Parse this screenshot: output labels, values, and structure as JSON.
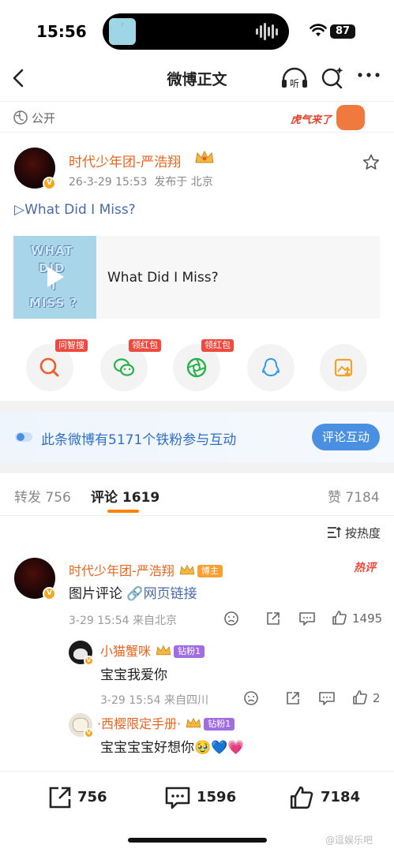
{
  "status_bar": {
    "time": "15:56",
    "battery": "87"
  },
  "navbar": {
    "title": "微博正文",
    "listen_label": "听"
  },
  "privacy": {
    "label": "公开",
    "badge_text": "虎气来了"
  },
  "post": {
    "author": "时代少年团-严浩翔",
    "time": "26-3-29 15:53",
    "location": "发布于 北京",
    "text": "▷What Did I Miss?",
    "media_title": "What Did I Miss?",
    "thumb_words": [
      "WHAT",
      "DID",
      "I",
      "MISS ?"
    ]
  },
  "share": {
    "tags": [
      "问智搜",
      "领红包",
      "领红包"
    ]
  },
  "banner": {
    "text": "此条微博有5171个铁粉参与互动",
    "button": "评论互动"
  },
  "tabs": {
    "repost": "转发 756",
    "comments": "评论 1619",
    "likes": "赞 7184"
  },
  "sort": {
    "label": "按热度"
  },
  "comments": [
    {
      "name": "时代少年团-严浩翔",
      "tag": "博主",
      "hot": "热评",
      "text_prefix": "图片评论",
      "link": "网页链接",
      "meta": "3-29 15:54  来自北京",
      "likes": "1495"
    },
    {
      "name": "小猫蟹咪",
      "tag": "钻粉1",
      "text": "宝宝我爱你",
      "meta": "3-29 15:54  来自四川",
      "likes": "2"
    },
    {
      "name": "·西樱限定手册·",
      "tag": "钻粉1",
      "text": "宝宝宝宝好想你🥹💙💗"
    }
  ],
  "bottom_bar": {
    "reposts": "756",
    "comments": "1596",
    "likes": "7184"
  },
  "watermark": "@逗娱乐吧",
  "colors": {
    "accent": "#ff8200",
    "author": "#e8661f",
    "link": "#4a6aa5",
    "banner_button": "#4a90e2"
  }
}
